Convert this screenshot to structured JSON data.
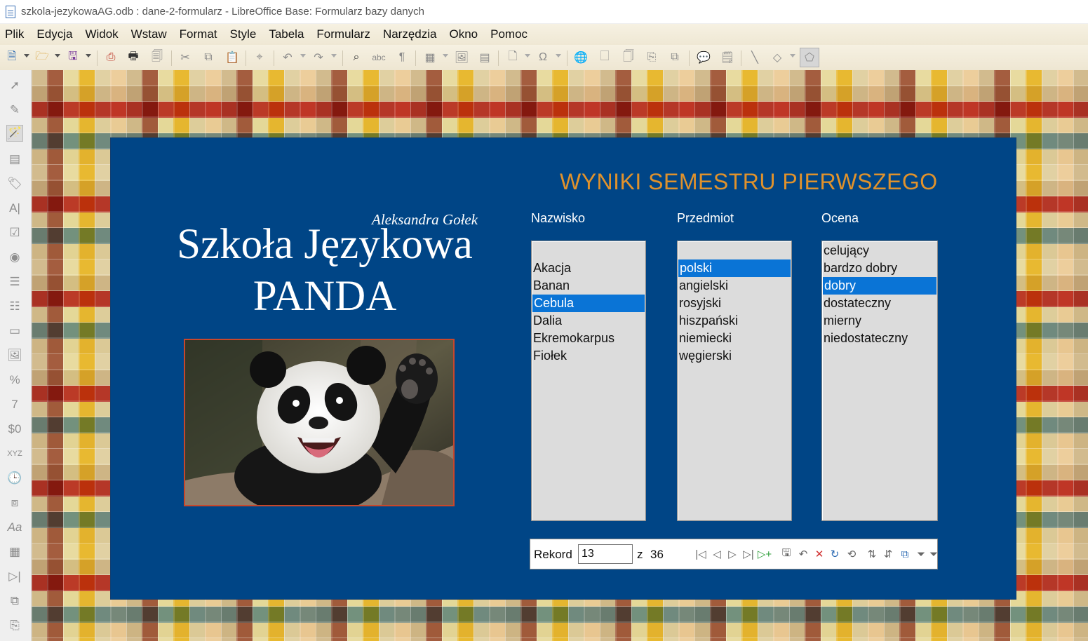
{
  "window": {
    "title": "szkola-jezykowaAG.odb : dane-2-formularz - LibreOffice Base: Formularz bazy danych"
  },
  "menu": [
    "Plik",
    "Edycja",
    "Widok",
    "Wstaw",
    "Format",
    "Style",
    "Tabela",
    "Formularz",
    "Narzędzia",
    "Okno",
    "Pomoc"
  ],
  "form": {
    "author": "Aleksandra Gołek",
    "school_title_line1": "Szkoła Językowa",
    "school_title_line2": "PANDA",
    "heading": "WYNIKI SEMESTRU PIERWSZEGO",
    "columns": {
      "nazwisko": {
        "label": "Nazwisko",
        "items": [
          "",
          "Akacja",
          "Banan",
          "Cebula",
          "Dalia",
          "Ekremokarpus",
          "Fiołek"
        ],
        "selected": 3
      },
      "przedmiot": {
        "label": "Przedmiot",
        "items": [
          "",
          "polski",
          "angielski",
          "rosyjski",
          "hiszpański",
          "niemiecki",
          "węgierski"
        ],
        "selected": 1
      },
      "ocena": {
        "label": "Ocena",
        "items": [
          "celujący",
          "bardzo dobry",
          "dobry",
          "dostateczny",
          "mierny",
          "niedostateczny"
        ],
        "selected": 2
      }
    },
    "navigator": {
      "label": "Rekord",
      "current": "13",
      "of": "z",
      "total": "36"
    }
  },
  "colors": {
    "panel_bg": "#004586",
    "heading": "#e0922c",
    "selection": "#0a74d6",
    "photo_border": "#c8472b"
  }
}
